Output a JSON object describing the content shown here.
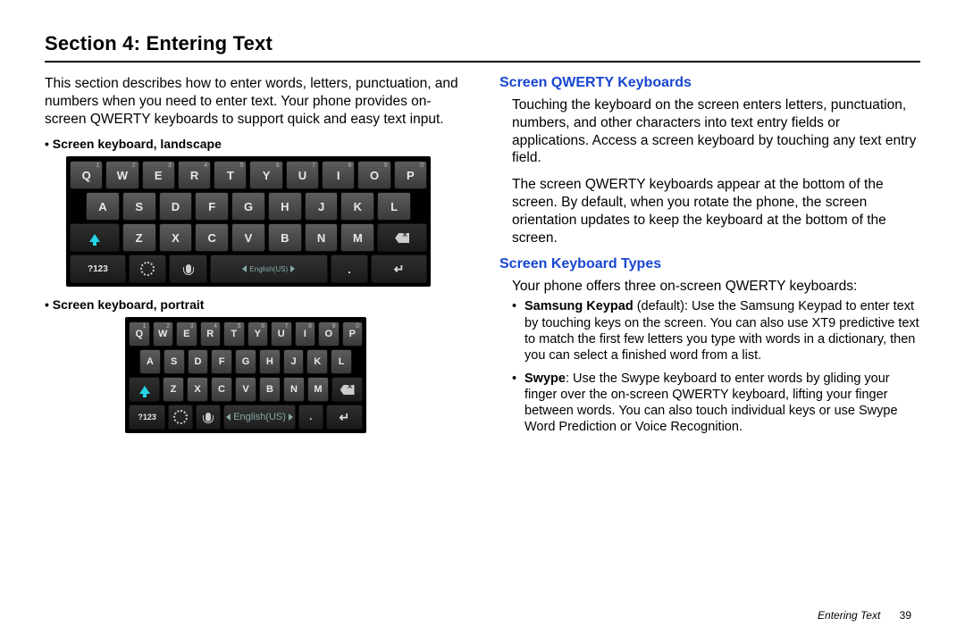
{
  "section_title": "Section 4: Entering Text",
  "left": {
    "intro": "This section describes how to enter words, letters, punctuation, and numbers when you need to enter text. Your phone provides on-screen QWERTY keyboards to support quick and easy text input.",
    "label_landscape": "• Screen keyboard, landscape",
    "label_portrait": "• Screen keyboard, portrait"
  },
  "keyboard": {
    "row1_letters": [
      "Q",
      "W",
      "E",
      "R",
      "T",
      "Y",
      "U",
      "I",
      "O",
      "P"
    ],
    "row1_sups": [
      "1",
      "2",
      "3",
      "4",
      "5",
      "6",
      "7",
      "8",
      "9",
      "0"
    ],
    "row2_letters": [
      "A",
      "S",
      "D",
      "F",
      "G",
      "H",
      "J",
      "K",
      "L"
    ],
    "row3_letters": [
      "Z",
      "X",
      "C",
      "V",
      "B",
      "N",
      "M"
    ],
    "sym_key": "?123",
    "comma": ",",
    "period": ".",
    "space_label": "English(US)"
  },
  "right": {
    "qwerty": {
      "heading": "Screen QWERTY Keyboards",
      "p1": "Touching the keyboard on the screen enters letters, punctuation, numbers, and other characters into text entry fields or applications. Access a screen keyboard by touching any text entry field.",
      "p2": "The screen QWERTY keyboards appear at the bottom of the screen. By default, when you rotate the phone, the screen orientation updates to keep the keyboard at the bottom of the screen."
    },
    "types": {
      "heading": "Screen Keyboard Types",
      "intro": "Your phone offers three on-screen QWERTY keyboards:",
      "items": [
        {
          "term": "Samsung Keypad",
          "suffix": " (default): Use the Samsung Keypad to enter text by touching keys on the screen. You can also use XT9 predictive text to match the first few letters you type with words in a dictionary, then you can select a finished word from a list."
        },
        {
          "term": "Swype",
          "suffix": ": Use the Swype keyboard to enter words by gliding your finger over the on-screen QWERTY keyboard, lifting your finger between words. You can also touch individual keys or use Swype Word Prediction or Voice Recognition."
        }
      ]
    }
  },
  "footer": {
    "title": "Entering Text",
    "page": "39"
  }
}
